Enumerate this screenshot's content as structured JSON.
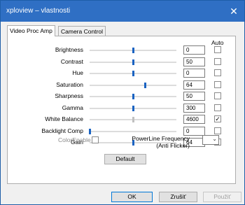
{
  "window": {
    "title": "xploview – vlastnosti",
    "close_glyph": "✕"
  },
  "tabs": [
    {
      "label": "Video Proc Amp",
      "active": true
    },
    {
      "label": "Camera Control",
      "active": false
    }
  ],
  "auto_header": "Auto",
  "properties": [
    {
      "label": "Brightness",
      "value": "0",
      "slider_fraction": 0.5,
      "auto": false,
      "enabled": true
    },
    {
      "label": "Contrast",
      "value": "50",
      "slider_fraction": 0.5,
      "auto": false,
      "enabled": true
    },
    {
      "label": "Hue",
      "value": "0",
      "slider_fraction": 0.5,
      "auto": false,
      "enabled": true
    },
    {
      "label": "Saturation",
      "value": "64",
      "slider_fraction": 0.64,
      "auto": false,
      "enabled": true
    },
    {
      "label": "Sharpness",
      "value": "50",
      "slider_fraction": 0.5,
      "auto": false,
      "enabled": true
    },
    {
      "label": "Gamma",
      "value": "300",
      "slider_fraction": 0.5,
      "auto": false,
      "enabled": true
    },
    {
      "label": "White Balance",
      "value": "4600",
      "slider_fraction": 0.5,
      "auto": true,
      "enabled": false
    },
    {
      "label": "Backlight Comp",
      "value": "0",
      "slider_fraction": 0.0,
      "auto": false,
      "enabled": true
    },
    {
      "label": "Gain",
      "value": "64",
      "slider_fraction": 0.5,
      "auto": false,
      "enabled": true
    }
  ],
  "color_enable": {
    "label": "ColorEnable",
    "checked": false
  },
  "powerline": {
    "label_line1": "PowerLine Frequency",
    "label_line2": "(Anti Flicker)",
    "selected": ""
  },
  "buttons": {
    "default_label": "Default",
    "ok_label": "OK",
    "cancel_label": "Zrušiť",
    "apply_label": "Použiť"
  },
  "icons": {
    "dropdown": "chevron-down-icon",
    "checkmark": "checkmark-icon"
  },
  "colors": {
    "titlebar": "#2f6fc4",
    "slider_thumb": "#1a63c2",
    "focus_border": "#0078d7"
  }
}
